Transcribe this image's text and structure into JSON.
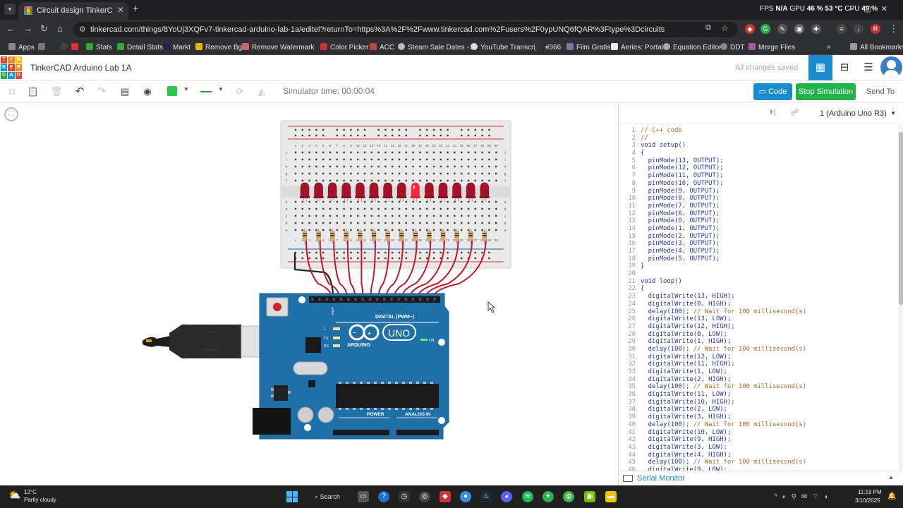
{
  "browser": {
    "tab_title": "Circuit design TinkerCAD Arduin...",
    "tab_close": "✕",
    "new_tab": "+",
    "url": "tinkercad.com/things/8YoUj3XQFv7-tinkercad-arduino-lab-1a/editel?returnTo=https%3A%2F%2Fwww.tinkercad.com%2Fusers%2F0ypUNQ6fQAR%3Ftype%3Dcircuits",
    "stats": {
      "fps_label": "FPS",
      "fps_value": "N/A",
      "gpu_label": "GPU",
      "gpu_value": "46 %",
      "temp": "53 °C",
      "cpu_label": "CPU",
      "cpu_value": "49 %"
    },
    "bookmarks": [
      "Apps",
      "Stats",
      "Detail Stats",
      "Markt",
      "Remove Bg",
      "Remove Watermark",
      "Color Picker",
      "ACC",
      "Steam Sale Dates -...",
      "YouTube Transcript",
      "#366",
      "Film Gratis",
      "Aeries: Portals",
      "Equation Editor",
      "DDT",
      "Merge Files",
      "All Bookmarks"
    ],
    "profile_letter": "R"
  },
  "app": {
    "logo_letters": [
      "T",
      "I",
      "N",
      "K",
      "E",
      "R",
      "C",
      "A",
      "D"
    ],
    "logo_colors": [
      "#e8412c",
      "#f28c1e",
      "#f2c20c",
      "#1a9bd7",
      "#e8412c",
      "#f28c1e",
      "#2aa84a",
      "#1a9bd7",
      "#e8412c"
    ],
    "design_title": "TinkerCAD Arduino Lab 1A",
    "save_status": "All changes saved",
    "sim_time": "Simulator time: 00:00:04",
    "code_button": "Code",
    "stop_button": "Stop Simulation",
    "send_button": "Send To",
    "device": "1 (Arduino Uno R3)",
    "serial_monitor": "Serial Monitor",
    "accent_color": "#1b8bd0",
    "go_color": "#21b24a"
  },
  "circuit": {
    "arduino_brand": "ARDUINO",
    "arduino_model": "UNO",
    "digital_label": "DIGITAL (PWM~)",
    "power_label": "POWER",
    "analog_label": "ANALOG IN",
    "on_label": "ON",
    "tx_label": "TX",
    "rx_label": "RX",
    "l_label": "L",
    "led_count": 14,
    "led_lit_index": 8,
    "breadboard_col_numbers": [
      "1",
      "2",
      "3",
      "4",
      "5",
      "6",
      "7",
      "8",
      "9",
      "10",
      "11",
      "12",
      "13",
      "14",
      "15",
      "16",
      "17",
      "18",
      "19",
      "20",
      "21",
      "22",
      "23",
      "24",
      "25",
      "26",
      "27",
      "28",
      "29",
      "30"
    ],
    "row_letters_top": [
      "j",
      "i",
      "h",
      "g",
      "f"
    ],
    "row_letters_bottom": [
      "e",
      "d",
      "c",
      "b",
      "a"
    ]
  },
  "code": {
    "start_line": 1,
    "lines": [
      "// C++ code",
      "//",
      "void setup()",
      "{",
      "  pinMode(13, OUTPUT);",
      "  pinMode(12, OUTPUT);",
      "  pinMode(11, OUTPUT);",
      "  pinMode(10, OUTPUT);",
      "  pinMode(9, OUTPUT);",
      "  pinMode(8, OUTPUT);",
      "  pinMode(7, OUTPUT);",
      "  pinMode(6, OUTPUT);",
      "  pinMode(0, OUTPUT);",
      "  pinMode(1, OUTPUT);",
      "  pinMode(2, OUTPUT);",
      "  pinMode(3, OUTPUT);",
      "  pinMode(4, OUTPUT);",
      "  pinMode(5, OUTPUT);",
      "}",
      "",
      "void loop()",
      "{",
      "  digitalWrite(13, HIGH);",
      "  digitalWrite(0, HIGH);",
      "  delay(100); // Wait for 100 millisecond(s)",
      "  digitalWrite(13, LOW);",
      "  digitalWrite(12, HIGH);",
      "  digitalWrite(0, LOW);",
      "  digitalWrite(1, HIGH);",
      "  delay(100); // Wait for 100 millisecond(s)",
      "  digitalWrite(12, LOW);",
      "  digitalWrite(11, HIGH);",
      "  digitalWrite(1, LOW);",
      "  digitalWrite(2, HIGH);",
      "  delay(100); // Wait for 100 millisecond(s)",
      "  digitalWrite(11, LOW);",
      "  digitalWrite(10, HIGH);",
      "  digitalWrite(2, LOW);",
      "  digitalWrite(3, HIGH);",
      "  delay(100); // Wait for 100 millisecond(s)",
      "  digitalWrite(10, LOW);",
      "  digitalWrite(9, HIGH);",
      "  digitalWrite(3, LOW);",
      "  digitalWrite(4, HIGH);",
      "  delay(100); // Wait for 100 millisecond(s)",
      "  digitalWrite(9, LOW);"
    ]
  },
  "taskbar": {
    "weather_temp": "12°C",
    "weather_desc": "Partly cloudy",
    "search_label": "Search",
    "time": "11:19 PM",
    "date": "3/10/2025"
  }
}
